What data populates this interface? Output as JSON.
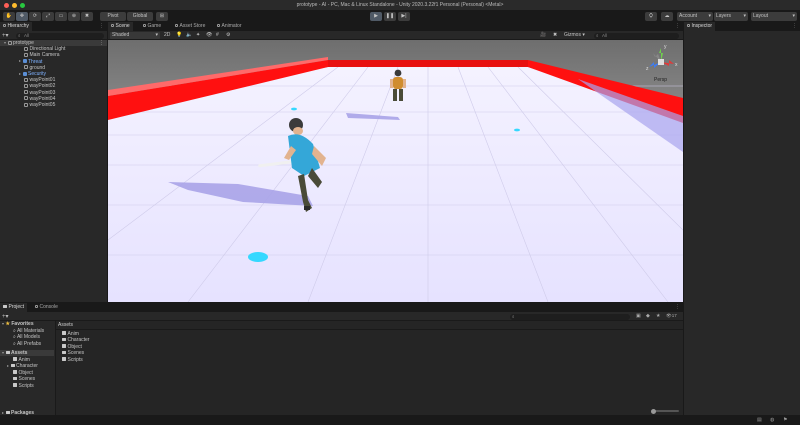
{
  "window": {
    "title": "prototype - AI - PC, Mac & Linux Standalone - Unity 2020.3.22f1 Personal (Personal) <Metal>"
  },
  "toolbar": {
    "pivot_label": "Pivot",
    "global_label": "Global",
    "account_label": "Account",
    "layers_label": "Layers",
    "layout_label": "Layout"
  },
  "hierarchy": {
    "tab_label": "Hierarchy",
    "search_placeholder": "All",
    "items": [
      {
        "label": "prototype",
        "style": "root"
      },
      {
        "label": "Directional Light",
        "style": "normal"
      },
      {
        "label": "Main Camera",
        "style": "normal"
      },
      {
        "label": "Threat",
        "style": "prefab"
      },
      {
        "label": "ground",
        "style": "normal"
      },
      {
        "label": "Security",
        "style": "prefab"
      },
      {
        "label": "wayPoint01",
        "style": "normal"
      },
      {
        "label": "wayPoint02",
        "style": "normal"
      },
      {
        "label": "wayPoint03",
        "style": "normal"
      },
      {
        "label": "wayPoint04",
        "style": "normal"
      },
      {
        "label": "wayPoint05",
        "style": "normal"
      }
    ]
  },
  "scene": {
    "tabs": [
      "Scene",
      "Game",
      "Asset Store",
      "Animator"
    ],
    "shading_mode": "Shaded",
    "view_2d_label": "2D",
    "gizmos_label": "Gizmos",
    "search_placeholder": "All",
    "persp_label": "Persp",
    "gizmo_axes": {
      "x": "x",
      "y": "y",
      "z": "z"
    }
  },
  "inspector": {
    "tab_label": "Inspector"
  },
  "project": {
    "tabs": [
      "Project",
      "Console"
    ],
    "badge": "17",
    "favorites_label": "Favorites",
    "favorites": [
      "All Materials",
      "All Models",
      "All Prefabs"
    ],
    "assets_label": "Assets",
    "asset_folders": [
      "Anim",
      "Character",
      "Object",
      "Scenes",
      "Scripts"
    ],
    "packages_label": "Packages",
    "breadcrumb": "Assets",
    "content": [
      "Anim",
      "Character",
      "Object",
      "Scenes",
      "Scripts"
    ]
  },
  "colors": {
    "editor_bg": "#282828",
    "toolbar_bg": "#191919",
    "floor": "#ece9ff",
    "wall": "#ff1010",
    "sky": "#c8c8c8",
    "accent": "#505a66",
    "waypoint": "#35d8ff",
    "player_shirt": "#34a7d8",
    "enemy_shirt": "#d08d2f"
  }
}
